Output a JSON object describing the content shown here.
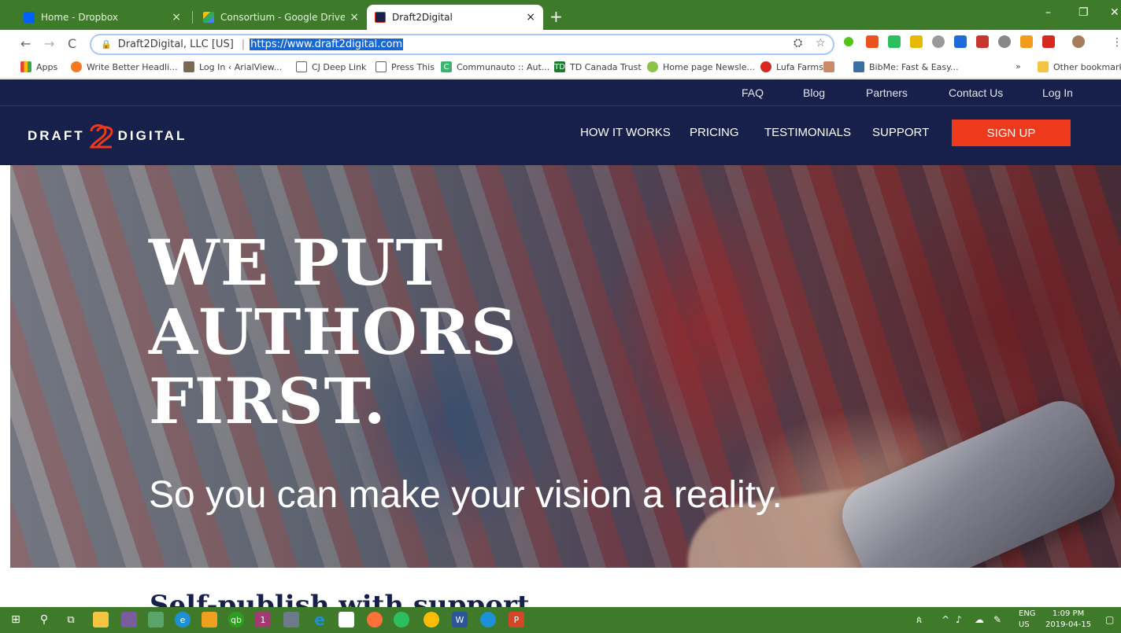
{
  "browser": {
    "tabs": [
      {
        "title": "Home - Dropbox",
        "icon": "dropbox-icon",
        "color": "#0061ff"
      },
      {
        "title": "Consortium - Google Drive",
        "icon": "google-drive-icon",
        "color": "#fbbc04"
      },
      {
        "title": "Draft2Digital",
        "icon": "draft2digital-icon",
        "color": "#16204a"
      }
    ],
    "new_tab": "+",
    "site_info": "Draft2Digital, LLC [US]",
    "url": "https://www.draft2digital.com",
    "bookmarks": [
      {
        "label": "Apps",
        "icon": "apps-grid-icon"
      },
      {
        "label": "Write Better Headli...",
        "icon": "coschedule-icon"
      },
      {
        "label": "Log In ‹ ArialView...",
        "icon": "arialview-icon"
      },
      {
        "label": "CJ Deep Link",
        "icon": "page-icon"
      },
      {
        "label": "Press This",
        "icon": "page-icon"
      },
      {
        "label": "Communauto :: Aut...",
        "icon": "communauto-icon"
      },
      {
        "label": "TD Canada Trust",
        "icon": "td-icon"
      },
      {
        "label": "Home page Newsle...",
        "icon": "tree-icon"
      },
      {
        "label": "Lufa Farms",
        "icon": "tomato-icon"
      },
      {
        "label": "BibMe: Fast & Easy...",
        "icon": "bibme-icon"
      },
      {
        "label": "Other bookmarks",
        "icon": "folder-icon"
      }
    ],
    "overflow": "»"
  },
  "site": {
    "top_nav": [
      "FAQ",
      "Blog",
      "Partners",
      "Contact Us",
      "Log In"
    ],
    "logo": {
      "left": "DRAFT",
      "right": "DIGITAL"
    },
    "main_nav": [
      "HOW IT WORKS",
      "PRICING",
      "TESTIMONIALS",
      "SUPPORT"
    ],
    "signup": "SIGN UP",
    "hero": {
      "line1": "WE PUT",
      "line2": "AUTHORS",
      "line3": "FIRST.",
      "subtitle": "So you can make your vision a reality."
    },
    "section_heading": "Self-publish with support"
  },
  "taskbar": {
    "lang1": "ENG",
    "lang2": "US",
    "time": "1:09 PM",
    "date": "2019-04-15"
  },
  "colors": {
    "navy": "#16204a",
    "signup": "#ee3a1c",
    "taskbar": "#3e7a2a"
  }
}
